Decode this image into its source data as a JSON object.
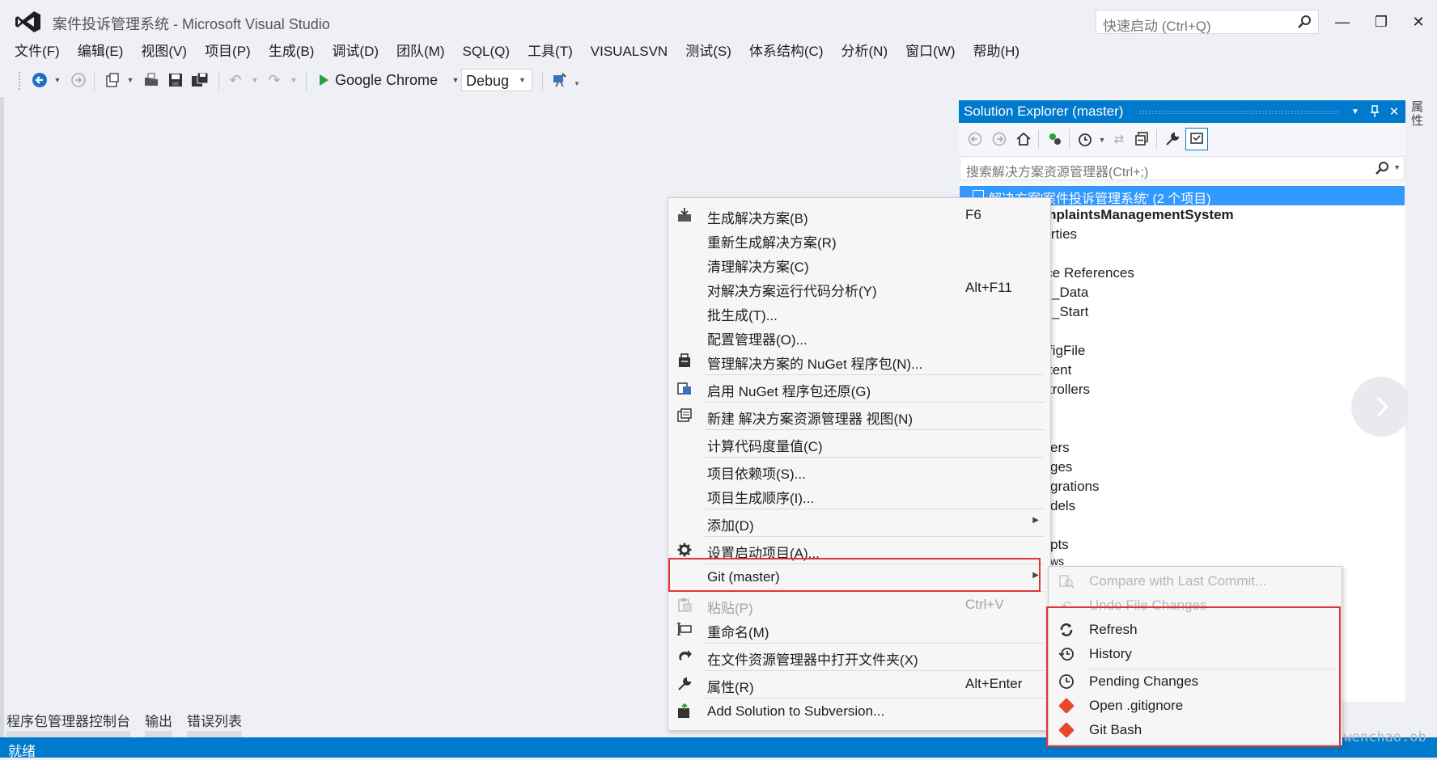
{
  "window": {
    "title": "案件投诉管理系统 - Microsoft Visual Studio",
    "quick_launch_placeholder": "快速启动 (Ctrl+Q)",
    "minimize": "—",
    "restore": "❐",
    "close": "✕"
  },
  "menubar": [
    "文件(F)",
    "编辑(E)",
    "视图(V)",
    "项目(P)",
    "生成(B)",
    "调试(D)",
    "团队(M)",
    "SQL(Q)",
    "工具(T)",
    "VISUALSVN",
    "测试(S)",
    "体系结构(C)",
    "分析(N)",
    "窗口(W)",
    "帮助(H)"
  ],
  "toolbar": {
    "run_target": "Google Chrome",
    "configuration": "Debug"
  },
  "solution_explorer": {
    "title": "Solution Explorer (master)",
    "search_placeholder": "搜索解决方案资源管理器(Ctrl+;)",
    "selected_item": "解决方案'案件投诉管理系统' (2 个项目)",
    "visible_items": [
      "omplaintsManagementSystem",
      "perties",
      "ᴉ",
      "vice References",
      "_Data",
      "_Start",
      "figFile",
      "tent",
      "trollers",
      "ers",
      "ges",
      "grations",
      "dels",
      "pts",
      "ws"
    ],
    "props_tab": "属性"
  },
  "context_menu": {
    "items": [
      {
        "label": "生成解决方案(B)",
        "shortcut": "F6",
        "icon": "build-icon"
      },
      {
        "label": "重新生成解决方案(R)",
        "shortcut": "",
        "icon": ""
      },
      {
        "label": "清理解决方案(C)",
        "shortcut": "",
        "icon": ""
      },
      {
        "label": "对解决方案运行代码分析(Y)",
        "shortcut": "Alt+F11",
        "icon": ""
      },
      {
        "label": "批生成(T)...",
        "shortcut": "",
        "icon": ""
      },
      {
        "label": "配置管理器(O)...",
        "shortcut": "",
        "icon": ""
      },
      {
        "label": "管理解决方案的 NuGet 程序包(N)...",
        "shortcut": "",
        "icon": "nuget-icon"
      },
      {
        "label": "启用 NuGet 程序包还原(G)",
        "shortcut": "",
        "icon": "package-restore-icon"
      },
      {
        "label": "新建 解决方案资源管理器 视图(N)",
        "shortcut": "",
        "icon": "new-view-icon"
      },
      {
        "label": "计算代码度量值(C)",
        "shortcut": "",
        "icon": ""
      },
      {
        "label": "项目依赖项(S)...",
        "shortcut": "",
        "icon": ""
      },
      {
        "label": "项目生成顺序(I)...",
        "shortcut": "",
        "icon": ""
      },
      {
        "label": "添加(D)",
        "shortcut": "",
        "icon": ""
      },
      {
        "label": "设置启动项目(A)...",
        "shortcut": "",
        "icon": "gear-icon"
      },
      {
        "label": "Git (master)",
        "shortcut": "",
        "icon": ""
      },
      {
        "label": "粘贴(P)",
        "shortcut": "Ctrl+V",
        "icon": "paste-icon"
      },
      {
        "label": "重命名(M)",
        "shortcut": "",
        "icon": "rename-icon"
      },
      {
        "label": "在文件资源管理器中打开文件夹(X)",
        "shortcut": "",
        "icon": "open-folder-icon"
      },
      {
        "label": "属性(R)",
        "shortcut": "Alt+Enter",
        "icon": "wrench-icon"
      },
      {
        "label": "Add Solution to Subversion...",
        "shortcut": "",
        "icon": "subversion-icon"
      }
    ]
  },
  "git_menu": {
    "items": [
      {
        "label": "Compare with Last Commit...",
        "disabled": true
      },
      {
        "label": "Undo File Changes",
        "disabled": true
      },
      {
        "label": "Refresh",
        "disabled": false
      },
      {
        "label": "History",
        "disabled": false
      },
      {
        "label": "Pending Changes",
        "disabled": false
      },
      {
        "label": "Open .gitignore",
        "disabled": false
      },
      {
        "label": "Git Bash",
        "disabled": false
      }
    ]
  },
  "bottom_tabs": [
    "程序包管理器控制台",
    "输出",
    "错误列表"
  ],
  "status": "就绪",
  "watermark": "https://blog.csdn.net/lwenchao.ob",
  "colors": {
    "accent": "#007acc",
    "highlight": "#e03535",
    "selection": "#3399ff"
  }
}
